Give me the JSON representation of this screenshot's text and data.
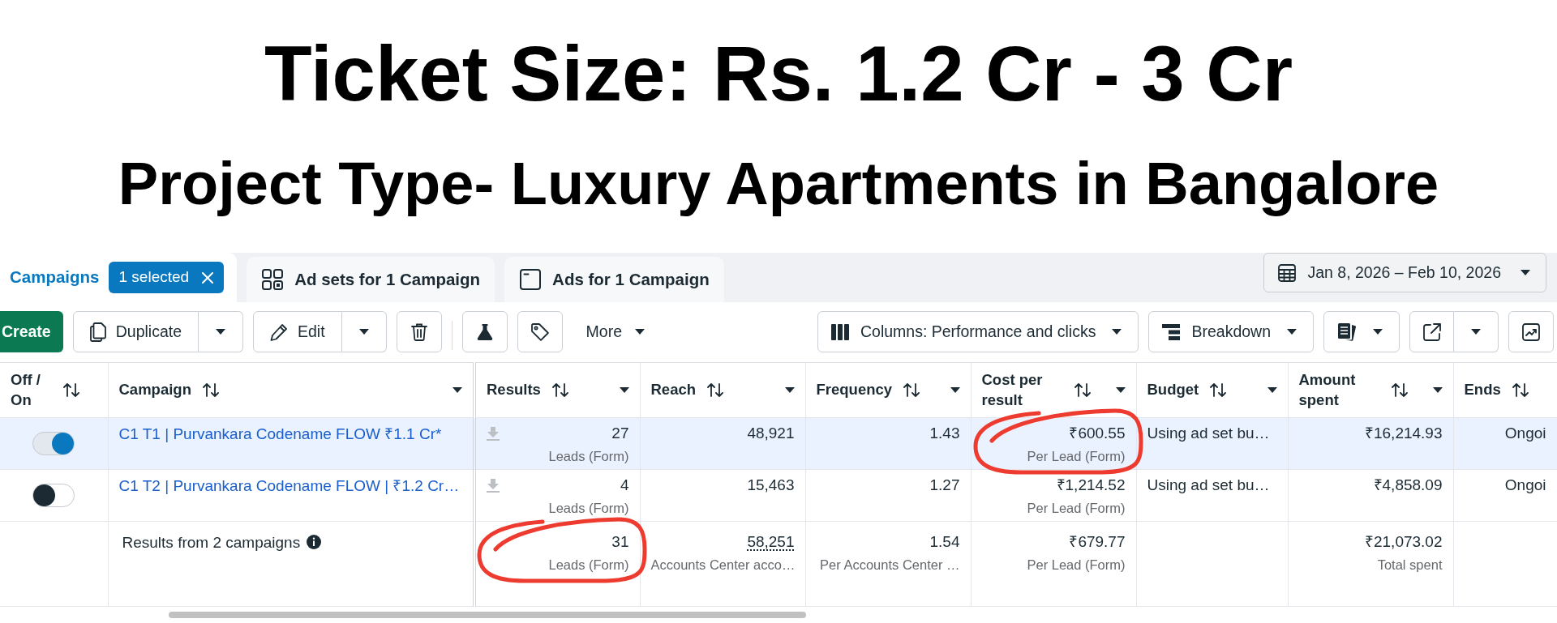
{
  "headline": "Ticket Size: Rs. 1.2 Cr - 3 Cr",
  "subheadline": "Project Type- Luxury Apartments in Bangalore",
  "tabs": [
    {
      "kind": "campaigns",
      "label": "Campaigns",
      "selected": true,
      "badge": "1 selected"
    },
    {
      "kind": "adsets",
      "label": "Ad sets for 1 Campaign",
      "selected": false
    },
    {
      "kind": "ads",
      "label": "Ads for 1 Campaign",
      "selected": false
    }
  ],
  "date_range": "Jan 8, 2026 – Feb 10, 2026",
  "toolbar": {
    "left_groups": [
      [
        {
          "kind": "create",
          "label": "Create"
        },
        {
          "kind": "duplicate",
          "label": "Duplicate"
        },
        {
          "kind": "edit",
          "label": "Edit"
        },
        {
          "kind": "delete"
        }
      ],
      [
        {
          "kind": "test"
        },
        {
          "kind": "tag"
        },
        {
          "kind": "more",
          "label": "More"
        }
      ]
    ],
    "right": [
      {
        "kind": "columns",
        "label": "Columns: Performance and clicks"
      },
      {
        "kind": "breakdown",
        "label": "Breakdown"
      },
      {
        "kind": "reports"
      },
      {
        "kind": "export"
      },
      {
        "kind": "insights"
      }
    ]
  },
  "table": {
    "columns": [
      {
        "kind": "toggle",
        "label": "Off / On",
        "menu": false
      },
      {
        "kind": "name",
        "label": "Campaign",
        "menu": true
      },
      {
        "kind": "metric",
        "label": "Results",
        "menu": true
      },
      {
        "kind": "metric",
        "label": "Reach",
        "menu": true
      },
      {
        "kind": "metric",
        "label": "Frequency",
        "menu": true
      },
      {
        "kind": "metric",
        "label": "Cost per result",
        "menu": true
      },
      {
        "kind": "text",
        "label": "Budget",
        "menu": true
      },
      {
        "kind": "metric",
        "label": "Amount spent",
        "menu": true
      },
      {
        "kind": "status",
        "label": "Ends",
        "menu": false
      }
    ],
    "rows": [
      {
        "selected": true,
        "cells": [
          {
            "on": true
          },
          {
            "value": "C1 T1 | Purvankara Codename FLOW ₹1.1 Cr*"
          },
          {
            "value": "27",
            "sub": "Leads (Form)",
            "download": true,
            "circled": false
          },
          {
            "value": "48,921",
            "download": false,
            "circled": false
          },
          {
            "value": "1.43",
            "download": false,
            "circled": false
          },
          {
            "value": "₹600.55",
            "sub": "Per Lead (Form)",
            "download": false,
            "circled": true
          },
          {
            "value": "Using ad set bu…",
            "download": false,
            "circled": false
          },
          {
            "value": "₹16,214.93",
            "download": false,
            "circled": false
          },
          {
            "value": "Ongoi",
            "download": false,
            "circled": false
          }
        ]
      },
      {
        "selected": false,
        "cells": [
          {
            "on": false
          },
          {
            "value": "C1 T2 | Purvankara Codename FLOW | ₹1.2 Cr…"
          },
          {
            "value": "4",
            "sub": "Leads (Form)",
            "download": true,
            "circled": false
          },
          {
            "value": "15,463",
            "download": false,
            "circled": false
          },
          {
            "value": "1.27",
            "download": false,
            "circled": false
          },
          {
            "value": "₹1,214.52",
            "sub": "Per Lead (Form)",
            "download": false,
            "circled": false
          },
          {
            "value": "Using ad set bu…",
            "download": false,
            "circled": false
          },
          {
            "value": "₹4,858.09",
            "download": false,
            "circled": false
          },
          {
            "value": "Ongoi",
            "download": false,
            "circled": false
          }
        ]
      }
    ],
    "summary": {
      "cells": [
        "",
        {
          "value": "Results from 2 campaigns"
        },
        {
          "value": "31",
          "sub": "Leads (Form)",
          "circled": true,
          "dotted": false
        },
        {
          "value": "58,251",
          "sub": "Accounts Center acco…",
          "circled": false,
          "dotted": true
        },
        {
          "value": "1.54",
          "sub": "Per Accounts Center …",
          "circled": false,
          "dotted": false
        },
        {
          "value": "₹679.77",
          "sub": "Per Lead (Form)",
          "circled": false,
          "dotted": false
        },
        "",
        {
          "value": "₹21,073.02",
          "sub": "Total spent",
          "circled": false,
          "dotted": false
        },
        ""
      ]
    }
  }
}
